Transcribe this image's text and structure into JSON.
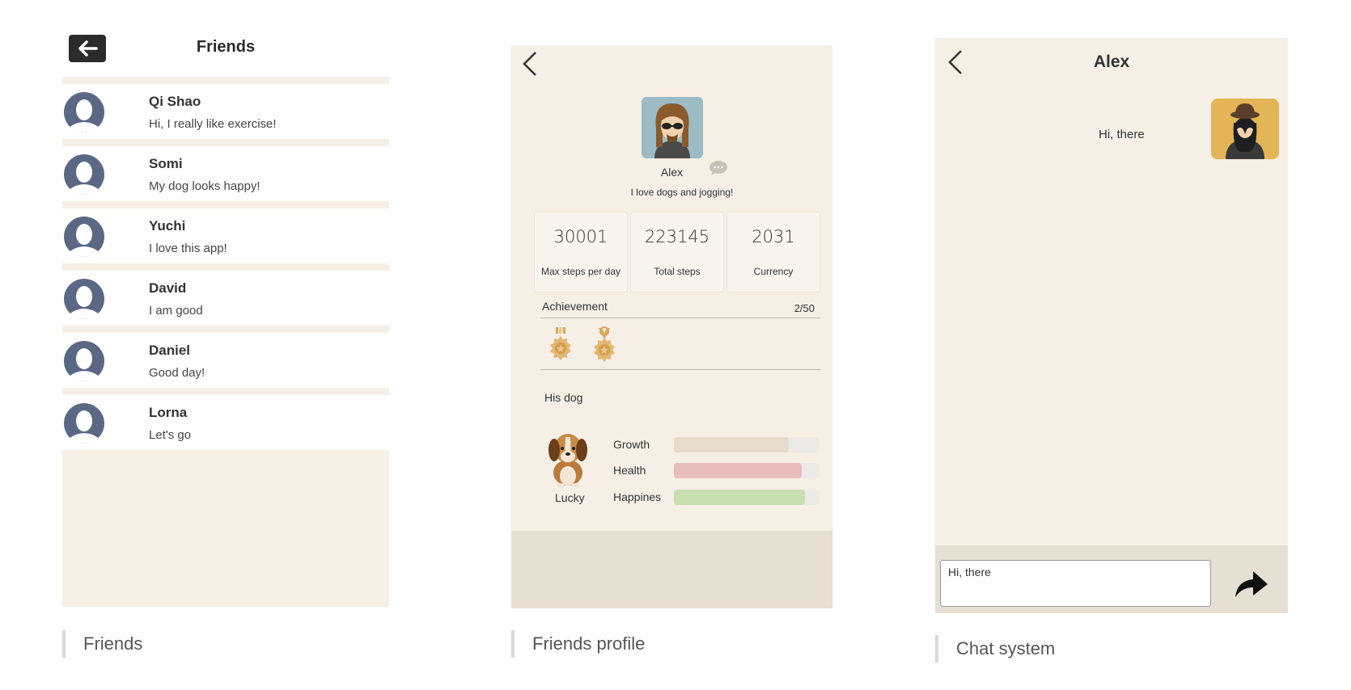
{
  "friends_screen": {
    "title": "Friends",
    "back_icon": "arrow-left-icon",
    "friends": [
      {
        "name": "Qi Shao",
        "message": "Hi, I really like exercise!"
      },
      {
        "name": "Somi",
        "message": "My dog looks happy!"
      },
      {
        "name": "Yuchi",
        "message": "I love this app!"
      },
      {
        "name": "David",
        "message": "I am good"
      },
      {
        "name": "Daniel",
        "message": "Good day!"
      },
      {
        "name": "Lorna",
        "message": "Let's go"
      }
    ],
    "caption": "Friends"
  },
  "profile_screen": {
    "back_icon": "chevron-left-icon",
    "name": "Alex",
    "bio": "I love dogs and jogging!",
    "stats": [
      {
        "value": "30001",
        "label": "Max steps per day"
      },
      {
        "value": "223145",
        "label": "Total steps"
      },
      {
        "value": "2031",
        "label": "Currency"
      }
    ],
    "achievement": {
      "title": "Achievement",
      "count": "2/50"
    },
    "dog": {
      "section_title": "His dog",
      "name": "Lucky",
      "bars": [
        {
          "label": "Growth",
          "value": 0.79,
          "color": "#e6dccb"
        },
        {
          "label": "Health",
          "value": 0.88,
          "color": "#e8bdbd"
        },
        {
          "label": "Happines",
          "value": 0.9,
          "color": "#c7dfb1"
        }
      ]
    },
    "caption": "Friends profile"
  },
  "chat_screen": {
    "back_icon": "chevron-left-icon",
    "title": "Alex",
    "messages": [
      {
        "text": "Hi, there"
      }
    ],
    "input_value": "Hi, there",
    "send_icon": "share-arrow-icon",
    "caption": "Chat system"
  },
  "colors": {
    "panel_bg": "#f6efe5",
    "footer_bg": "#e6dfd4",
    "avatar_blue": "#5a6885"
  }
}
